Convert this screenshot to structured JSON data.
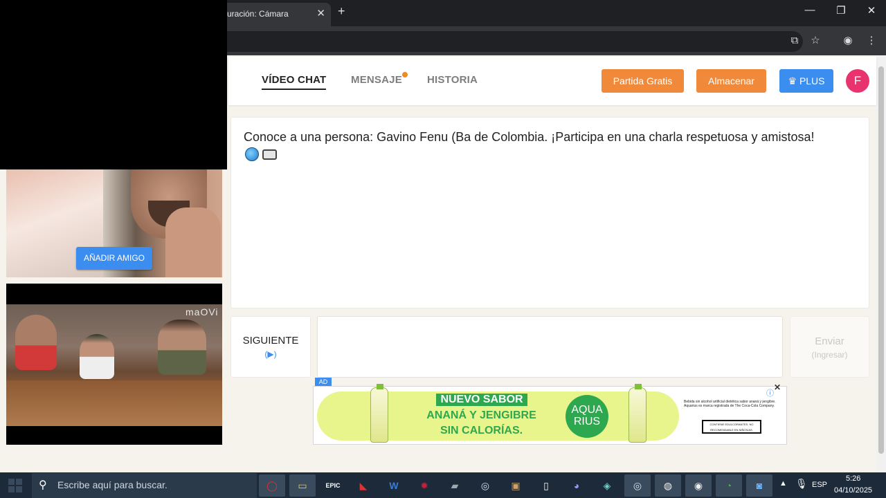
{
  "browser": {
    "tab_title": "uración: Cámara",
    "tab_close": "✕",
    "new_tab": "+",
    "window": {
      "minimize": "—",
      "maximize": "❐",
      "close": "✕"
    }
  },
  "nav": {
    "video_chat": "VÍDEO CHAT",
    "mensaje": "MENSAJE",
    "historia": "HISTORIA",
    "partida_gratis": "Partida Gratis",
    "almacenar": "Almacenar",
    "plus": "PLUS",
    "avatar_initial": "F",
    "colors": {
      "orange": "#f08a3a",
      "blue": "#3c8df0",
      "avatar": "#e8336e"
    }
  },
  "chat": {
    "intro": "Conoce a una persona: Gavino Fenu (Ba de Colombia. ¡Participa en una charla respetuosa y amistosa!",
    "siguiente": "SIGUIENTE",
    "siguiente_key": "(▶)",
    "message_value": "",
    "enviar": "Enviar",
    "enviar_key": "(Ingresar)"
  },
  "video": {
    "add_friend": "AÑADIR AMIGO",
    "watermark": "maOVi"
  },
  "ad": {
    "badge": "AD",
    "line1": "NUEVO SABOR",
    "line2": "ANANÁ Y JENGIBRE",
    "line3": "SIN CALORÍAS.",
    "logo_top": "AQUA",
    "logo_bottom": "RIUS",
    "legal": "Bebida sin alcohol artificial dietética sabor ananá y jengibre. Aquarius es marca registrada de The Coca-Cola Company.",
    "warning": "CONTIENE EDULCORANTES. NO RECOMENDABLE EN NIÑOS/AS.",
    "close": "✕",
    "info": "ⓘ"
  },
  "taskbar": {
    "search_placeholder": "Escribe aquí para buscar.",
    "lang": "ESP",
    "time": "5:26",
    "date": "04/10/2025"
  }
}
